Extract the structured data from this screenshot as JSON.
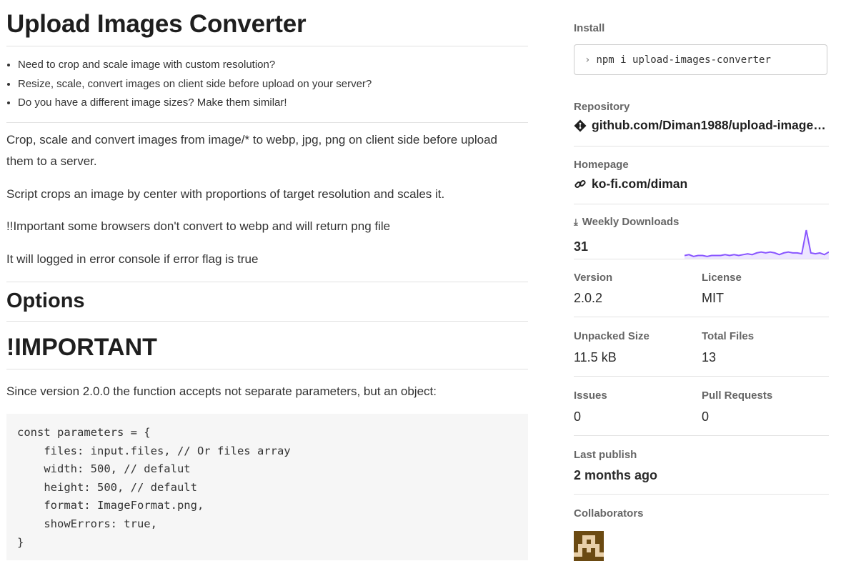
{
  "main": {
    "title": "Upload Images Converter",
    "bullets": [
      "Need to crop and scale image with custom resolution?",
      "Resize, scale, convert images on client side before upload on your server?",
      "Do you have a different image sizes? Make them similar!"
    ],
    "paragraphs": [
      "Crop, scale and convert images from image/* to webp, jpg, png on client side before upload them to a server.",
      "Script crops an image by center with proportions of target resolution and scales it.",
      "!!Important some browsers don't convert to webp and will return png file",
      "It will logged in error console if error flag is true"
    ],
    "h_options": "Options",
    "h_important": "!IMPORTANT",
    "since_text": "Since version 2.0.0 the function accepts not separate parameters, but an object:",
    "code": "const parameters = {\n    files: input.files, // Or files array\n    width: 500, // defalut\n    height: 500, // default\n    format: ImageFormat.png,\n    showErrors: true,\n}"
  },
  "sidebar": {
    "install_label": "Install",
    "install_prompt_icon": "chevron-right-icon",
    "install_command": "npm i upload-images-converter",
    "repository_label": "Repository",
    "repository_icon": "git-icon",
    "repository_value": "github.com/Diman1988/upload-images-...",
    "homepage_label": "Homepage",
    "homepage_icon": "link-icon",
    "homepage_value": "ko-fi.com/diman",
    "weekly_downloads_label": "Weekly Downloads",
    "weekly_downloads_icon": "download-icon",
    "weekly_downloads_value": "31",
    "version_label": "Version",
    "version_value": "2.0.2",
    "license_label": "License",
    "license_value": "MIT",
    "unpacked_size_label": "Unpacked Size",
    "unpacked_size_value": "11.5 kB",
    "total_files_label": "Total Files",
    "total_files_value": "13",
    "issues_label": "Issues",
    "issues_value": "0",
    "pull_requests_label": "Pull Requests",
    "pull_requests_value": "0",
    "last_publish_label": "Last publish",
    "last_publish_value": "2 months ago",
    "collaborators_label": "Collaborators",
    "accent_color": "#8956ff"
  },
  "chart_data": {
    "type": "area",
    "values": [
      2,
      3,
      1,
      2,
      2,
      1,
      2,
      2,
      2,
      3,
      2,
      3,
      2,
      3,
      4,
      3,
      5,
      6,
      5,
      6,
      5,
      3,
      5,
      6,
      5,
      5,
      4,
      31,
      5,
      4,
      5,
      3,
      6
    ]
  }
}
